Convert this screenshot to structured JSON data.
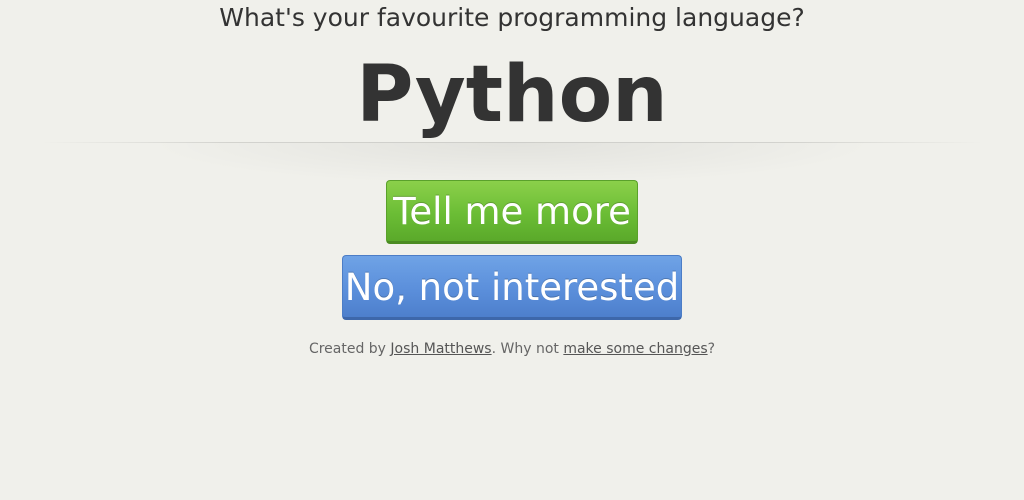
{
  "header": {
    "question": "What's your favourite programming language?",
    "answer": "Python"
  },
  "actions": {
    "more_label": "Tell me more",
    "reject_label": "No, not interested"
  },
  "footer": {
    "prefix": "Created by ",
    "author_link": "Josh Matthews",
    "middle": ". Why not ",
    "changes_link": "make some changes",
    "suffix": "?"
  },
  "colors": {
    "background": "#f0f0eb",
    "text": "#333333",
    "green_button": "#6bbd35",
    "blue_button": "#5b8fdb"
  }
}
